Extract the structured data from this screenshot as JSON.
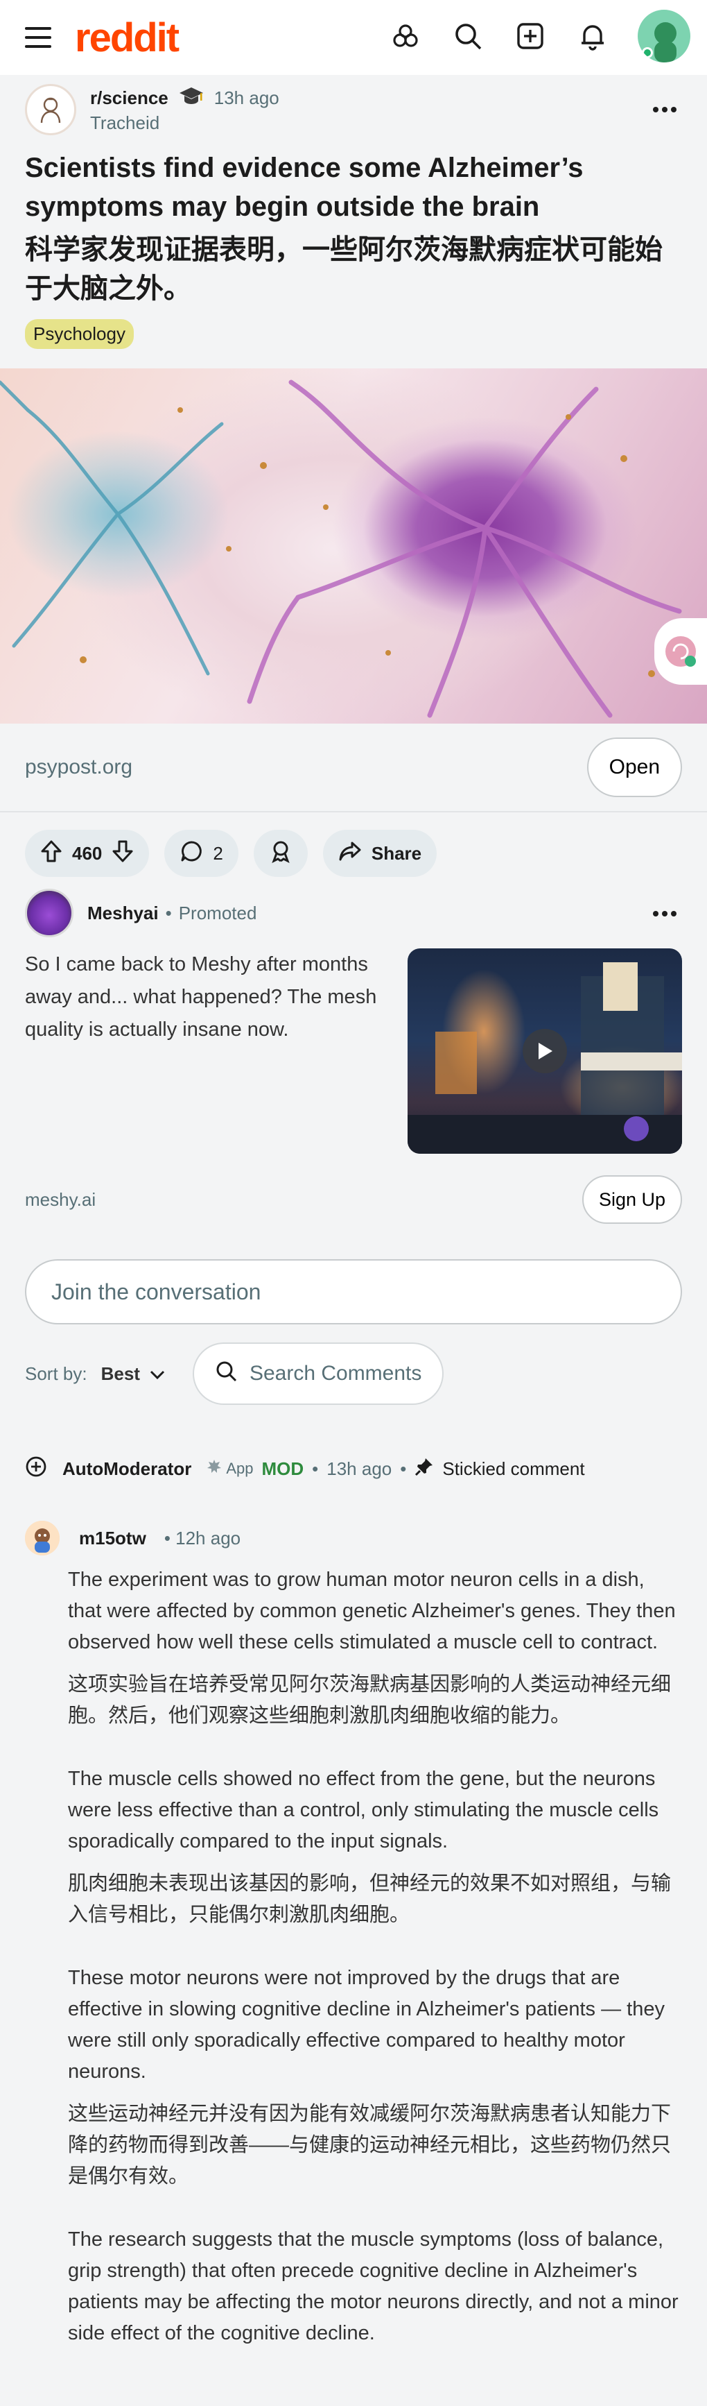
{
  "app": {
    "logo_text": "reddit",
    "brand_color": "#ff4500"
  },
  "post": {
    "subreddit": "r/science",
    "time_ago": "13h ago",
    "author": "Tracheid",
    "title_en": "Scientists find evidence some Alzheimer’s symptoms may begin outside the brain",
    "title_zh": "科学家发现证据表明，一些阿尔茨海默病症状可能始于大脑之外。",
    "flair": "Psychology",
    "link_domain": "psypost.org",
    "open_label": "Open",
    "votes": "460",
    "comments": "2",
    "share_label": "Share"
  },
  "ad": {
    "advertiser": "Meshyai",
    "separator": "•",
    "promoted_label": "Promoted",
    "text": "So I came back to Meshy after months away and... what happened? The mesh quality is actually insane now.",
    "domain": "meshy.ai",
    "cta_label": "Sign Up"
  },
  "composer": {
    "placeholder": "Join the conversation"
  },
  "sort": {
    "label": "Sort by:",
    "value": "Best",
    "search_placeholder": "Search Comments"
  },
  "automod": {
    "name": "AutoModerator",
    "app_label": "App",
    "mod_label": "MOD",
    "sep1": "•",
    "time": "13h ago",
    "sep2": "•",
    "stickied": "Stickied comment"
  },
  "comment": {
    "user": "m15otw",
    "time": "• 12h ago",
    "paragraphs": [
      {
        "en": "The experiment was to grow human motor neuron cells in a dish, that were affected by common genetic Alzheimer's genes. They then observed how well these cells stimulated a muscle cell to contract.",
        "zh": "这项实验旨在培养受常见阿尔茨海默病基因影响的人类运动神经元细胞。然后，他们观察这些细胞刺激肌肉细胞收缩的能力。"
      },
      {
        "en": "The muscle cells showed no effect from the gene, but the neurons were less effective than a control, only stimulating the muscle cells sporadically compared to the input signals.",
        "zh": "肌肉细胞未表现出该基因的影响，但神经元的效果不如对照组，与输入信号相比，只能偶尔刺激肌肉细胞。"
      },
      {
        "en": "These motor neurons were not improved by the drugs that are effective in slowing cognitive decline in Alzheimer's patients — they were still only sporadically effective compared to healthy motor neurons.",
        "zh": "这些运动神经元并没有因为能有效减缓阿尔茨海默病患者认知能力下降的药物而得到改善——与健康的运动神经元相比，这些药物仍然只是偶尔有效。"
      },
      {
        "en": "The research suggests that the muscle symptoms (loss of balance, grip strength) that often precede cognitive decline in Alzheimer's patients may be affecting the motor neurons directly, and not a minor side effect of the cognitive decline.",
        "zh": ""
      }
    ]
  },
  "icons": [
    "menu-icon",
    "avatars-icon",
    "search-icon",
    "create-post-icon",
    "bell-icon",
    "user-avatar",
    "more-icon",
    "upvote-icon",
    "downvote-icon",
    "comment-icon",
    "award-icon",
    "share-icon",
    "chevron-down-icon",
    "add-circle-icon",
    "pin-icon"
  ]
}
